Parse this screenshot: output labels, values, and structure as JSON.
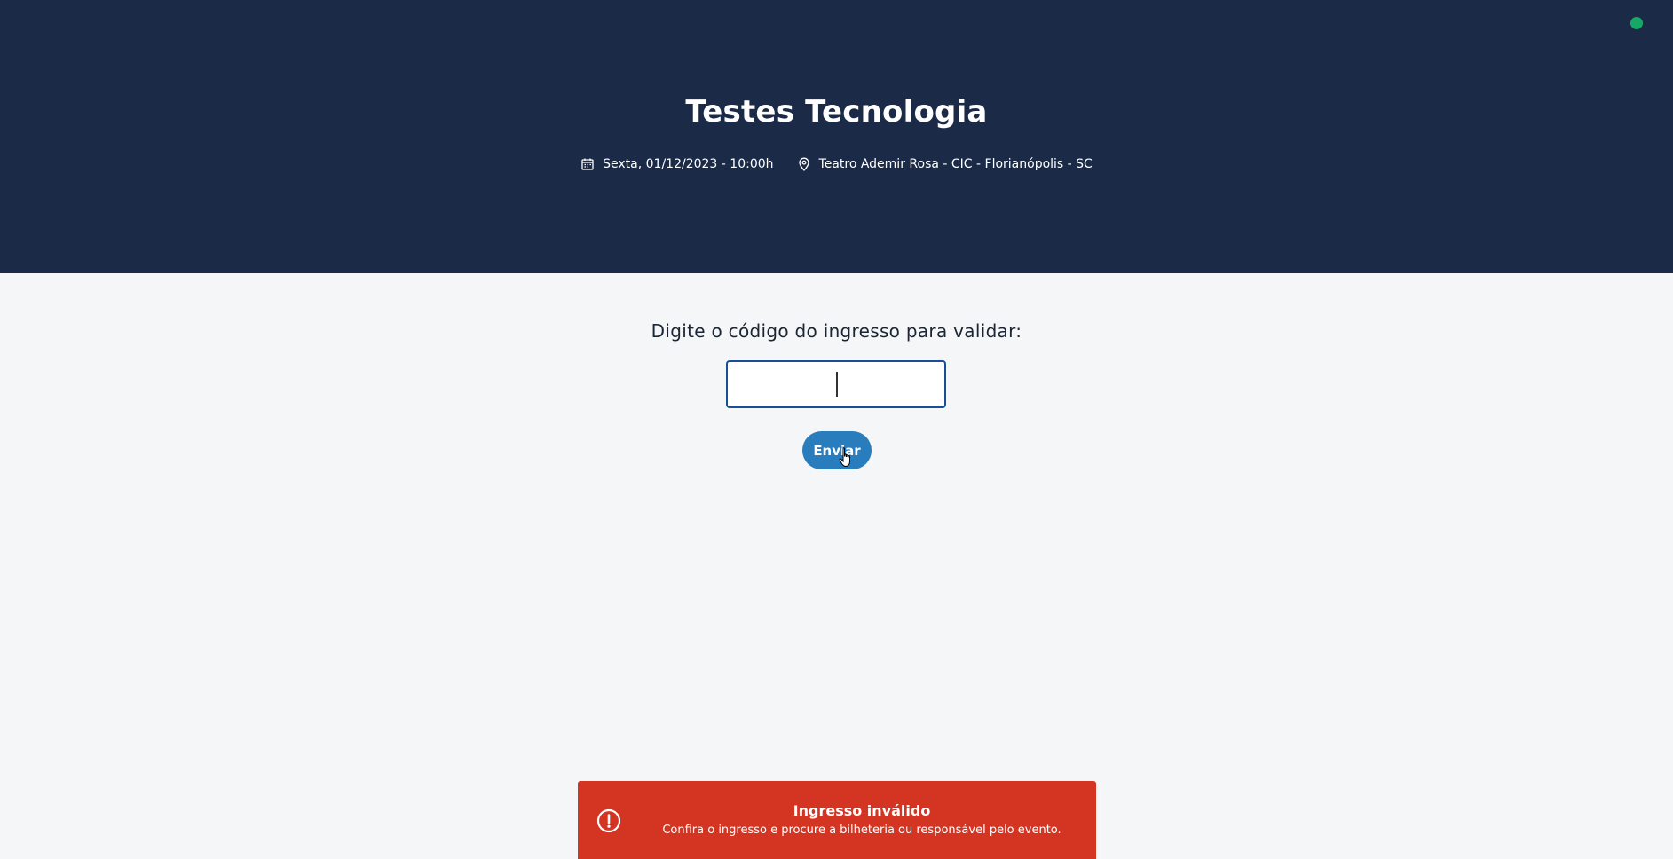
{
  "header": {
    "title": "Testes Tecnologia",
    "date_text": "Sexta, 01/12/2023 - 10:00h",
    "date_icon": "calendar-icon",
    "location_text": "Teatro Ademir Rosa - CIC - Florianópolis - SC",
    "location_icon": "map-pin-icon",
    "status_color": "#16a865",
    "background_color": "#1b2a47"
  },
  "validation": {
    "prompt": "Digite o código do ingresso para validar:",
    "input_value": "",
    "input_placeholder": "",
    "submit_label": "Enviar",
    "submit_color": "#2a7dbd"
  },
  "toast": {
    "icon": "alert-circle-icon",
    "title": "Ingresso inválido",
    "message": "Confira o ingresso e procure a bilheteria ou responsável pelo evento.",
    "color": "#d43422"
  }
}
